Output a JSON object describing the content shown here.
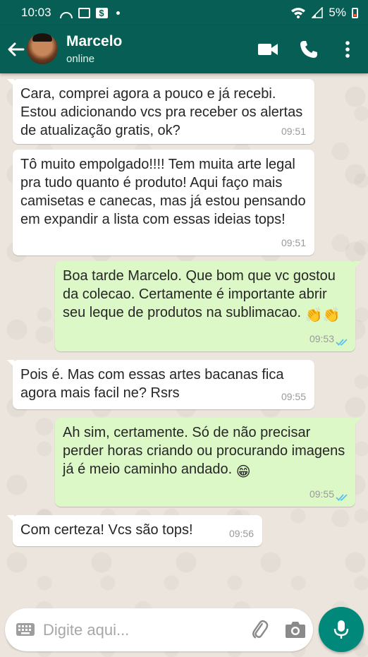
{
  "status_bar": {
    "time": "10:03",
    "battery_percent": "5%"
  },
  "header": {
    "contact_name": "Marcelo",
    "contact_status": "online"
  },
  "messages": [
    {
      "direction": "incoming",
      "text": "Cara, comprei agora a pouco e já recebi. Estou adicionando vcs pra receber os alertas de atualização gratis, ok?",
      "time": "09:51"
    },
    {
      "direction": "incoming",
      "text": "Tô muito empolgado!!!! Tem muita arte legal pra tudo quanto é produto! Aqui faço mais camisetas e canecas, mas já estou pensando em expandir a lista com essas ideias tops!",
      "time": "09:51"
    },
    {
      "direction": "outgoing",
      "text": "Boa tarde Marcelo. Que bom que vc gostou da colecao. Certamente é importante abrir seu leque de produtos na sublimacao.",
      "emoji": "👏👏",
      "time": "09:53",
      "read": true
    },
    {
      "direction": "incoming",
      "text": "Pois é. Mas com essas artes bacanas fica agora mais facil ne? Rsrs",
      "time": "09:55"
    },
    {
      "direction": "outgoing",
      "text": "Ah sim, certamente. Só de não precisar perder horas criando ou procurando imagens já é meio caminho andado.",
      "emoji": "😁",
      "time": "09:55",
      "read": true
    },
    {
      "direction": "incoming",
      "text": "Com certeza! Vcs são tops!",
      "time": "09:56"
    }
  ],
  "composer": {
    "placeholder": "Digite aqui..."
  },
  "colors": {
    "header": "#075e54",
    "outgoing_bubble": "#dcf8c6",
    "incoming_bubble": "#ffffff",
    "mic_button": "#00897b",
    "read_ticks": "#4fc3f7"
  },
  "icons": {
    "back": "arrow-left-icon",
    "video": "video-camera-icon",
    "call": "phone-icon",
    "menu": "more-vertical-icon",
    "keyboard": "keyboard-icon",
    "attach": "paperclip-icon",
    "camera": "camera-icon",
    "mic": "microphone-icon"
  }
}
